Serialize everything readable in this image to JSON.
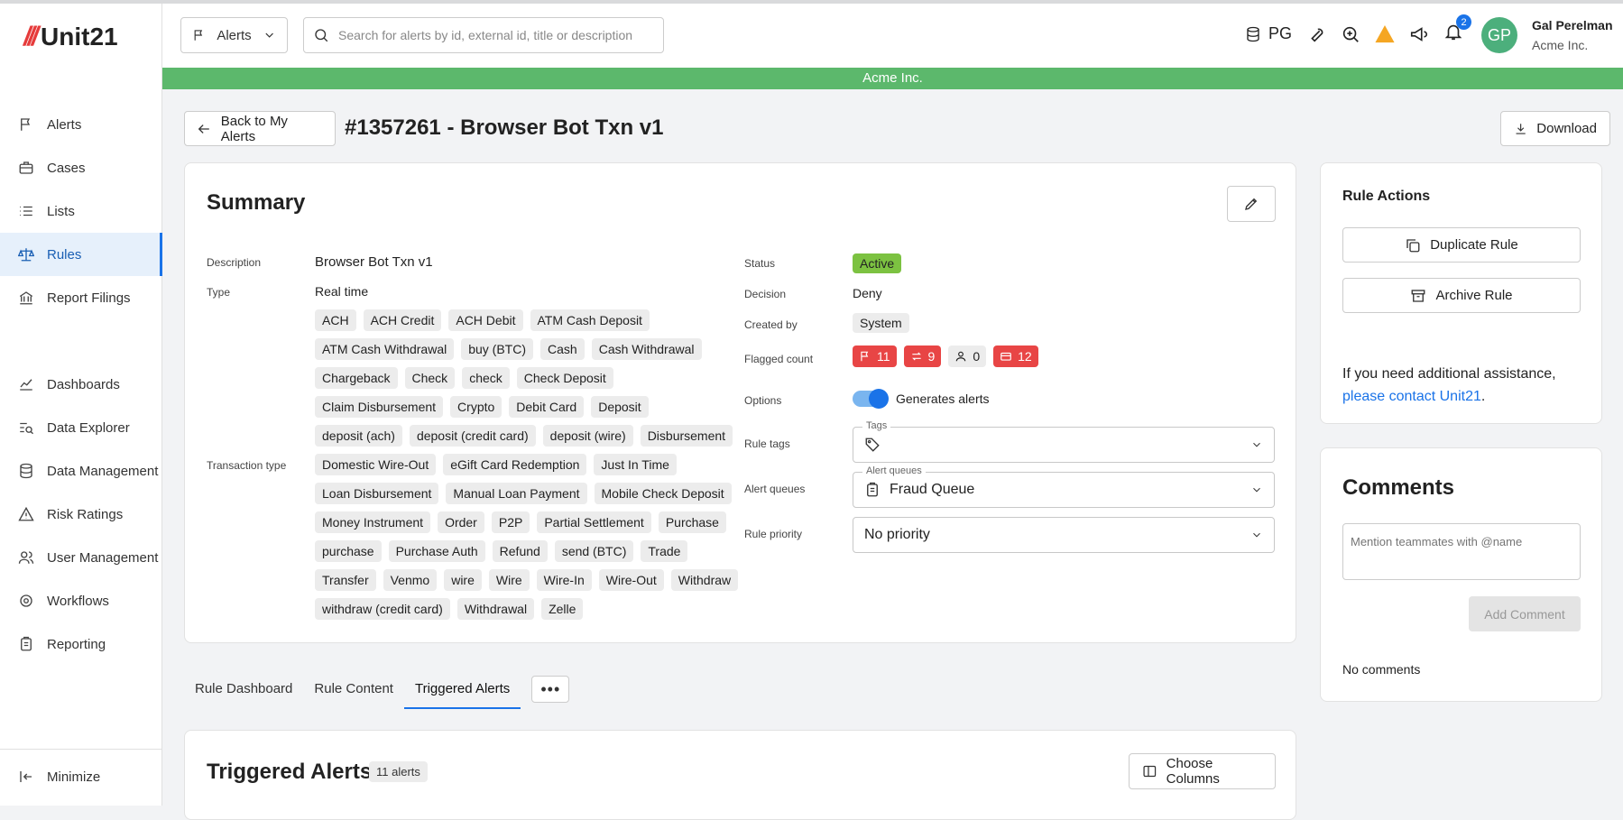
{
  "app": {
    "name": "Unit21"
  },
  "sidebar": {
    "items": [
      {
        "label": "Alerts"
      },
      {
        "label": "Cases"
      },
      {
        "label": "Lists"
      },
      {
        "label": "Rules"
      },
      {
        "label": "Report Filings"
      },
      {
        "label": "Dashboards"
      },
      {
        "label": "Data Explorer"
      },
      {
        "label": "Data Management"
      },
      {
        "label": "Risk Ratings"
      },
      {
        "label": "User Management"
      },
      {
        "label": "Workflows"
      },
      {
        "label": "Reporting"
      }
    ],
    "active": "Rules",
    "minimize_label": "Minimize"
  },
  "header": {
    "scope_dropdown": "Alerts",
    "search_placeholder": "Search for alerts by id, external id, title or description",
    "db_label": "PG",
    "notification_count": "2",
    "avatar_initials": "GP",
    "user_name": "Gal Perelman",
    "user_org": "Acme Inc."
  },
  "banner": {
    "text": "Acme Inc."
  },
  "page": {
    "back_label": "Back to My Alerts",
    "title": "#1357261 - Browser Bot Txn v1",
    "download_label": "Download"
  },
  "summary": {
    "heading": "Summary",
    "description_label": "Description",
    "description": "Browser Bot Txn v1",
    "type_label": "Type",
    "type": "Real time",
    "transaction_type_label": "Transaction type",
    "transaction_types": [
      "ACH",
      "ACH Credit",
      "ACH Debit",
      "ATM Cash Deposit",
      "ATM Cash Withdrawal",
      "buy (BTC)",
      "Cash",
      "Cash Withdrawal",
      "Chargeback",
      "Check",
      "check",
      "Check Deposit",
      "Claim Disbursement",
      "Crypto",
      "Debit Card",
      "Deposit",
      "deposit (ach)",
      "deposit (credit card)",
      "deposit (wire)",
      "Disbursement",
      "Domestic Wire-Out",
      "eGift Card Redemption",
      "Just In Time",
      "Loan Disbursement",
      "Manual Loan Payment",
      "Mobile Check Deposit",
      "Money Instrument",
      "Order",
      "P2P",
      "Partial Settlement",
      "Purchase",
      "purchase",
      "Purchase Auth",
      "Refund",
      "send (BTC)",
      "Trade",
      "Transfer",
      "Venmo",
      "wire",
      "Wire",
      "Wire-In",
      "Wire-Out",
      "Withdraw",
      "withdraw (credit card)",
      "Withdrawal",
      "Zelle"
    ],
    "status_label": "Status",
    "status": "Active",
    "decision_label": "Decision",
    "decision": "Deny",
    "created_by_label": "Created by",
    "created_by": "System",
    "flagged_count_label": "Flagged count",
    "flagged": {
      "alerts": "11",
      "transactions": "9",
      "entities": "0",
      "instruments": "12"
    },
    "options_label": "Options",
    "generates_alerts_label": "Generates alerts",
    "rule_tags_label": "Rule tags",
    "rule_tags_float": "Tags",
    "alert_queues_label": "Alert queues",
    "alert_queues_float": "Alert queues",
    "alert_queue_value": "Fraud Queue",
    "rule_priority_label": "Rule priority",
    "rule_priority_value": "No priority"
  },
  "tabs": {
    "items": [
      "Rule Dashboard",
      "Rule Content",
      "Triggered Alerts"
    ],
    "active": "Triggered Alerts"
  },
  "triggered": {
    "heading": "Triggered Alerts",
    "count": "11 alerts",
    "choose_columns": "Choose Columns"
  },
  "rule_actions": {
    "heading": "Rule Actions",
    "duplicate": "Duplicate Rule",
    "archive": "Archive Rule",
    "assist_text": "If you need additional assistance,",
    "assist_link": "please contact Unit21",
    "assist_end": "."
  },
  "comments": {
    "heading": "Comments",
    "placeholder": "Mention teammates with @name",
    "add_label": "Add Comment",
    "empty": "No comments"
  },
  "colors": {
    "accent": "#1a73e8",
    "banner": "#5cb86c",
    "active_status": "#7cc241",
    "flag_red": "#e84545"
  }
}
